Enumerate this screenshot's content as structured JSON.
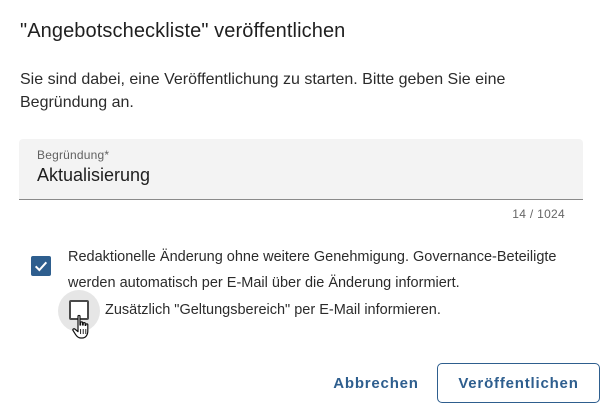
{
  "dialog": {
    "title": "\"Angebotscheckliste\" veröffentlichen",
    "message": "Sie sind dabei, eine Veröffentlichung zu starten. Bitte geben Sie eine Begründung an."
  },
  "reason_field": {
    "label": "Begründung*",
    "value": "Aktualisierung",
    "counter": "14 / 1024"
  },
  "options": {
    "editorial_change": {
      "label": "Redaktionelle Änderung ohne weitere Genehmigung. Governance-Beteiligte werden automatisch per E-Mail über die Änderung informiert.",
      "checked": true
    },
    "notify_scope": {
      "label": "Zusätzlich \"Geltungsbereich\" per E-Mail informieren.",
      "checked": false
    }
  },
  "actions": {
    "cancel_label": "Abbrechen",
    "publish_label": "Veröffentlichen"
  },
  "colors": {
    "accent": "#2e5e8e",
    "field_background": "#f3f3f3"
  }
}
